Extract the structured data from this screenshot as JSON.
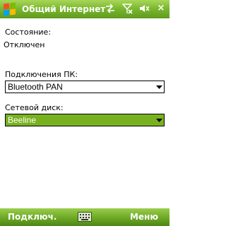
{
  "titlebar": {
    "title": "Общий Интернет",
    "icons": [
      "windows-start-icon",
      "sync-arrows-icon",
      "signal-off-icon",
      "speaker-icon",
      "close-icon"
    ],
    "close_label": "×"
  },
  "content": {
    "status_label": "Состояние:",
    "status_value": "Отключен",
    "pc_connection_label": "Подключения ПК:",
    "pc_connection_value": "Bluetooth PAN",
    "network_label": "Сетевой диск:",
    "network_value": "Beeline"
  },
  "menubar": {
    "left_softkey": "Подключ.",
    "right_softkey": "Меню",
    "center_icon": "keyboard-icon"
  },
  "colors": {
    "accent": "#78b11f",
    "bar_top": "#a9d65a",
    "bar_bottom": "#5f9a1e"
  }
}
